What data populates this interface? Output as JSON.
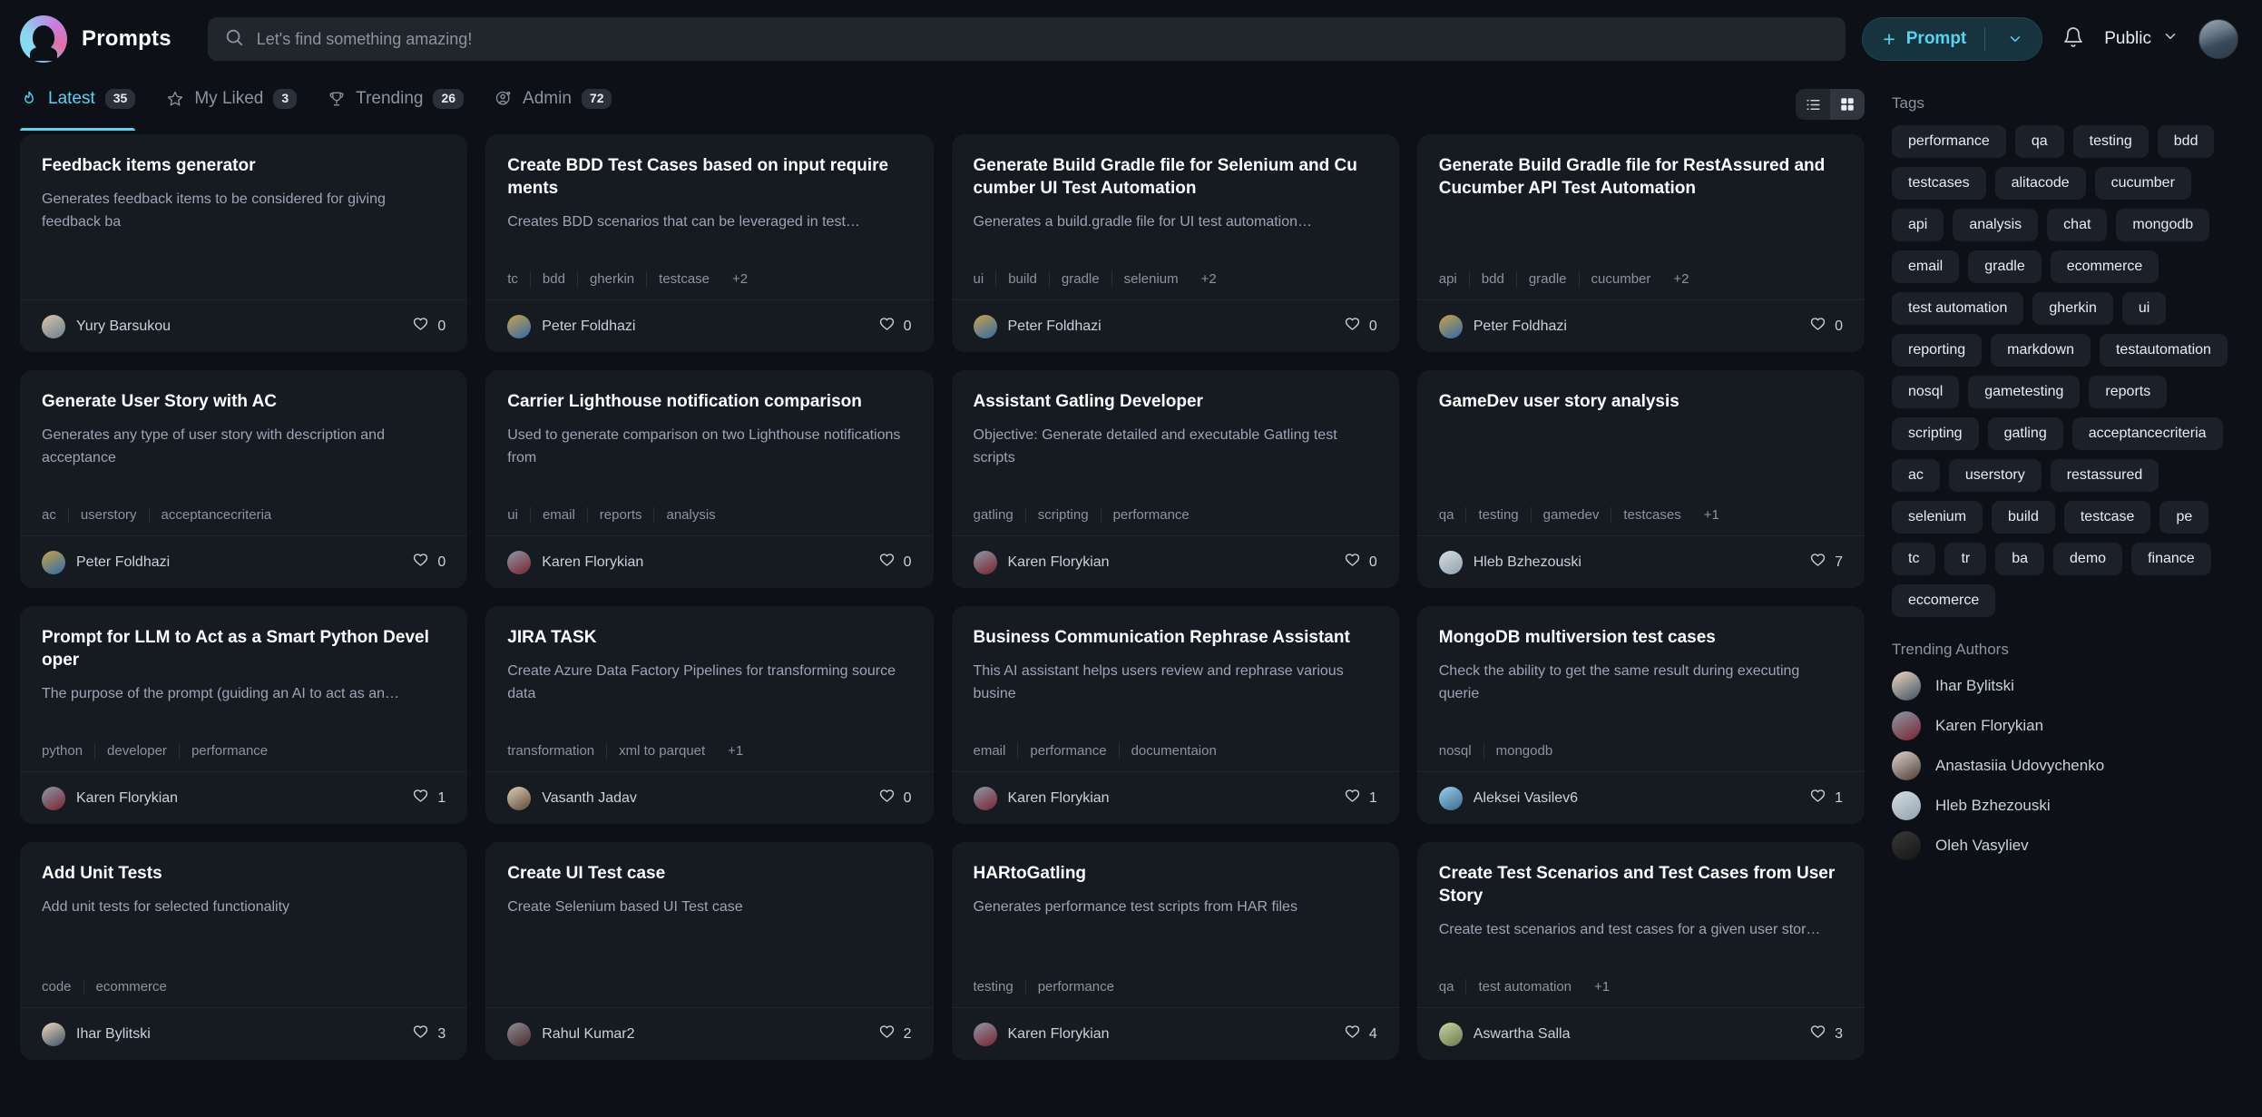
{
  "brand": {
    "name": "Prompts",
    "logo_icon": "prompts-logo-icon"
  },
  "search": {
    "placeholder": "Let's find something amazing!",
    "value": "",
    "icon": "search-icon"
  },
  "header": {
    "new_prompt_label": "Prompt",
    "plus_icon": "plus-icon",
    "caret_icon": "chevron-down-icon",
    "bell_icon": "bell-icon",
    "visibility_label": "Public",
    "visibility_caret_icon": "chevron-down-icon",
    "avatar_icon": "user-avatar"
  },
  "tabs": [
    {
      "label": "Latest",
      "count": "35",
      "icon": "flame-icon",
      "active": true
    },
    {
      "label": "My Liked",
      "count": "3",
      "icon": "star-icon",
      "active": false
    },
    {
      "label": "Trending",
      "count": "26",
      "icon": "trophy-icon",
      "active": false
    },
    {
      "label": "Admin",
      "count": "72",
      "icon": "user-gear-icon",
      "active": false
    }
  ],
  "view_toggle": {
    "list_icon": "list-view-icon",
    "grid_icon": "grid-view-icon",
    "selected": "grid"
  },
  "cards": [
    {
      "title": "Feedback items generator",
      "desc": "Generates feedback items to be considered for giving feedback ba",
      "tags": [],
      "more": "",
      "author": "Yury Barsukou",
      "likes": "0",
      "avatar_from": "#d9c3a8",
      "avatar_to": "#6b7f8f"
    },
    {
      "title": "Create BDD Test Cases based on input require ments",
      "desc": "Creates BDD scenarios that can be leveraged in test…",
      "tags": [
        "tc",
        "bdd",
        "gherkin",
        "testcase"
      ],
      "more": "+2",
      "author": "Peter Foldhazi",
      "likes": "0",
      "avatar_from": "#c9a14a",
      "avatar_to": "#2f6aa8"
    },
    {
      "title": "Generate Build Gradle file for Selenium and Cu cumber UI Test Automation",
      "desc": "Generates a build.gradle file for UI test automation…",
      "tags": [
        "ui",
        "build",
        "gradle",
        "selenium"
      ],
      "more": "+2",
      "author": "Peter Foldhazi",
      "likes": "0",
      "avatar_from": "#c9a14a",
      "avatar_to": "#2f6aa8"
    },
    {
      "title": "Generate Build Gradle file for RestAssured and Cucumber API Test Automation",
      "desc": "",
      "tags": [
        "api",
        "bdd",
        "gradle",
        "cucumber"
      ],
      "more": "+2",
      "author": "Peter Foldhazi",
      "likes": "0",
      "avatar_from": "#c9a14a",
      "avatar_to": "#2f6aa8"
    },
    {
      "title": "Generate User Story with AC",
      "desc": "Generates any type of user story with description and acceptance",
      "tags": [
        "ac",
        "userstory",
        "acceptancecriteria"
      ],
      "more": "",
      "author": "Peter Foldhazi",
      "likes": "0",
      "avatar_from": "#c9a14a",
      "avatar_to": "#2f6aa8"
    },
    {
      "title": "Carrier Lighthouse notification comparison",
      "desc": "Used to generate comparison on two Lighthouse notifications from",
      "tags": [
        "ui",
        "email",
        "reports",
        "analysis"
      ],
      "more": "",
      "author": "Karen Florykian",
      "likes": "0",
      "avatar_from": "#8d99a6",
      "avatar_to": "#7a2233"
    },
    {
      "title": "Assistant Gatling Developer",
      "desc": "Objective: Generate detailed and executable Gatling test scripts",
      "tags": [
        "gatling",
        "scripting",
        "performance"
      ],
      "more": "",
      "author": "Karen Florykian",
      "likes": "0",
      "avatar_from": "#8d99a6",
      "avatar_to": "#7a2233"
    },
    {
      "title": "GameDev user story analysis",
      "desc": "",
      "tags": [
        "qa",
        "testing",
        "gamedev",
        "testcases"
      ],
      "more": "+1",
      "author": "Hleb Bzhezouski",
      "likes": "7",
      "avatar_from": "#d8dde2",
      "avatar_to": "#8fa0ad"
    },
    {
      "title": "Prompt for LLM to Act as a Smart Python Devel oper",
      "desc": "The purpose of the prompt (guiding an AI to act as an…",
      "tags": [
        "python",
        "developer",
        "performance"
      ],
      "more": "",
      "author": "Karen Florykian",
      "likes": "1",
      "avatar_from": "#8d99a6",
      "avatar_to": "#7a2233"
    },
    {
      "title": "JIRA TASK",
      "desc": "Create Azure Data Factory Pipelines for transforming source data",
      "tags": [
        "transformation",
        "xml to parquet"
      ],
      "more": "+1",
      "author": "Vasanth Jadav",
      "likes": "0",
      "avatar_from": "#e0cdb8",
      "avatar_to": "#5c4a3a"
    },
    {
      "title": "Business Communication Rephrase Assistant",
      "desc": "This AI assistant helps users review and rephrase various busine",
      "tags": [
        "email",
        "performance",
        "documentaion"
      ],
      "more": "",
      "author": "Karen Florykian",
      "likes": "1",
      "avatar_from": "#8d99a6",
      "avatar_to": "#7a2233"
    },
    {
      "title": "MongoDB multiversion test cases",
      "desc": "Check the ability to get the same result during executing querie",
      "tags": [
        "nosql",
        "mongodb"
      ],
      "more": "",
      "author": "Aleksei Vasilev6",
      "likes": "1",
      "avatar_from": "#9ad0ef",
      "avatar_to": "#3b6a8c"
    },
    {
      "title": "Add Unit Tests",
      "desc": "Add unit tests for selected functionality",
      "tags": [
        "code",
        "ecommerce"
      ],
      "more": "",
      "author": "Ihar Bylitski",
      "likes": "3",
      "avatar_from": "#f0d8bd",
      "avatar_to": "#3c4f63"
    },
    {
      "title": "Create UI Test case",
      "desc": "Create Selenium based UI Test case",
      "tags": [],
      "more": "",
      "author": "Rahul Kumar2",
      "likes": "2",
      "avatar_from": "#8b8f96",
      "avatar_to": "#4a2b2b"
    },
    {
      "title": "HARtoGatling",
      "desc": "Generates performance test scripts from HAR files",
      "tags": [
        "testing",
        "performance"
      ],
      "more": "",
      "author": "Karen Florykian",
      "likes": "4",
      "avatar_from": "#8d99a6",
      "avatar_to": "#7a2233"
    },
    {
      "title": "Create Test Scenarios and Test Cases from User Story",
      "desc": "Create test scenarios and test cases for a given user stor…",
      "tags": [
        "qa",
        "test automation"
      ],
      "more": "+1",
      "author": "Aswartha Salla",
      "likes": "3",
      "avatar_from": "#c7d6a8",
      "avatar_to": "#6b7a4a"
    }
  ],
  "rail": {
    "tags_title": "Tags",
    "tags": [
      "performance",
      "qa",
      "testing",
      "bdd",
      "testcases",
      "alitacode",
      "cucumber",
      "api",
      "analysis",
      "chat",
      "mongodb",
      "email",
      "gradle",
      "ecommerce",
      "test automation",
      "gherkin",
      "ui",
      "reporting",
      "markdown",
      "testautomation",
      "nosql",
      "gametesting",
      "reports",
      "scripting",
      "gatling",
      "acceptancecriteria",
      "ac",
      "userstory",
      "restassured",
      "selenium",
      "build",
      "testcase",
      "pe",
      "tc",
      "tr",
      "ba",
      "demo",
      "finance",
      "eccomerce"
    ],
    "authors_title": "Trending Authors",
    "authors": [
      {
        "name": "Ihar Bylitski",
        "avatar_from": "#f0d8bd",
        "avatar_to": "#3c4f63"
      },
      {
        "name": "Karen Florykian",
        "avatar_from": "#8d99a6",
        "avatar_to": "#7a2233"
      },
      {
        "name": "Anastasiia Udovychenko",
        "avatar_from": "#ded6cf",
        "avatar_to": "#4b3a33"
      },
      {
        "name": "Hleb Bzhezouski",
        "avatar_from": "#d8dde2",
        "avatar_to": "#8fa0ad"
      },
      {
        "name": "Oleh Vasyliev",
        "avatar_from": "#3a3a3a",
        "avatar_to": "#141414"
      }
    ]
  },
  "colors": {
    "accent": "#56d4f0",
    "bg": "#0d1117",
    "card": "#161b22",
    "pill": "#1c2129"
  }
}
